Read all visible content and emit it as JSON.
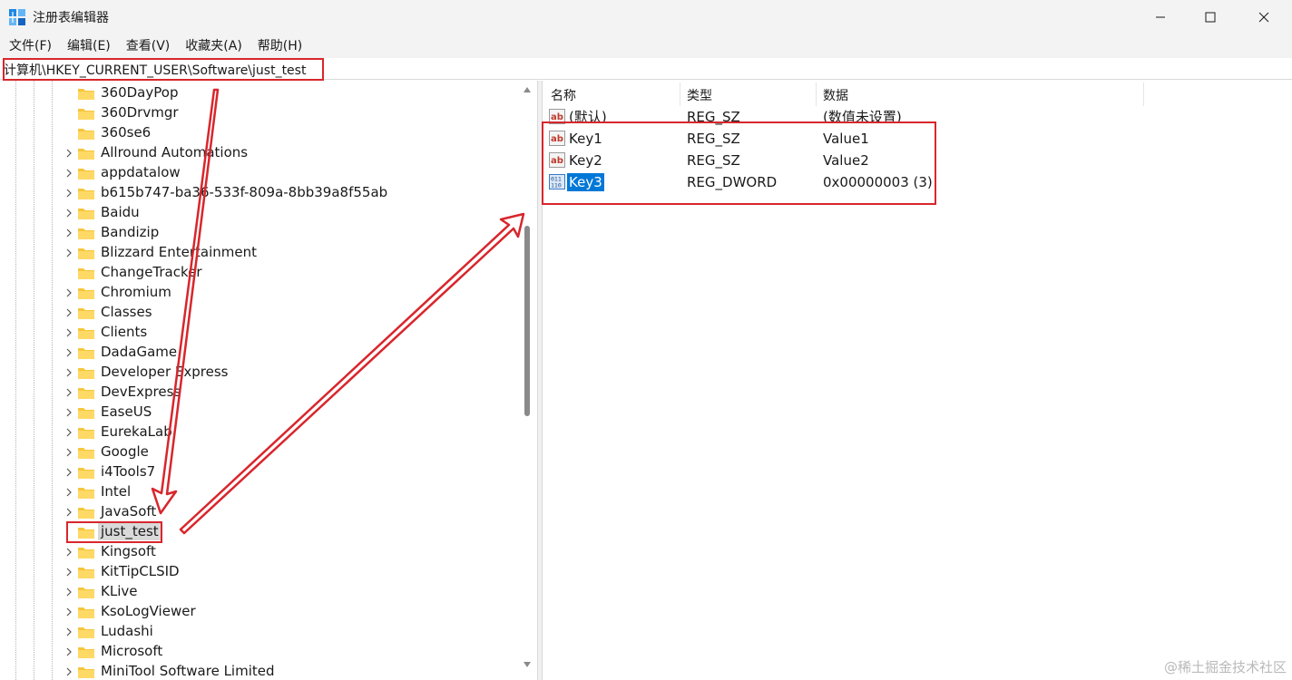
{
  "window": {
    "title": "注册表编辑器",
    "minimize_icon": "minimize-icon",
    "maximize_icon": "maximize-icon",
    "close_icon": "close-icon"
  },
  "menu": [
    "文件(F)",
    "编辑(E)",
    "查看(V)",
    "收藏夹(A)",
    "帮助(H)"
  ],
  "address": "计算机\\HKEY_CURRENT_USER\\Software\\just_test",
  "tree": {
    "items": [
      {
        "label": "360DayPop",
        "expandable": false
      },
      {
        "label": "360Drvmgr",
        "expandable": false
      },
      {
        "label": "360se6",
        "expandable": false
      },
      {
        "label": "Allround Automations",
        "expandable": true
      },
      {
        "label": "appdatalow",
        "expandable": true
      },
      {
        "label": "b615b747-ba36-533f-809a-8bb39a8f55ab",
        "expandable": true
      },
      {
        "label": "Baidu",
        "expandable": true
      },
      {
        "label": "Bandizip",
        "expandable": true
      },
      {
        "label": "Blizzard Entertainment",
        "expandable": true
      },
      {
        "label": "ChangeTracker",
        "expandable": false
      },
      {
        "label": "Chromium",
        "expandable": true
      },
      {
        "label": "Classes",
        "expandable": true
      },
      {
        "label": "Clients",
        "expandable": true
      },
      {
        "label": "DadaGame",
        "expandable": true
      },
      {
        "label": "Developer Express",
        "expandable": true
      },
      {
        "label": "DevExpress",
        "expandable": true
      },
      {
        "label": "EaseUS",
        "expandable": true
      },
      {
        "label": "EurekaLab",
        "expandable": true
      },
      {
        "label": "Google",
        "expandable": true
      },
      {
        "label": "i4Tools7",
        "expandable": true
      },
      {
        "label": "Intel",
        "expandable": true
      },
      {
        "label": "JavaSoft",
        "expandable": true
      },
      {
        "label": "just_test",
        "expandable": false,
        "selected": true
      },
      {
        "label": "Kingsoft",
        "expandable": true
      },
      {
        "label": "KitTipCLSID",
        "expandable": true
      },
      {
        "label": "KLive",
        "expandable": true
      },
      {
        "label": "KsoLogViewer",
        "expandable": true
      },
      {
        "label": "Ludashi",
        "expandable": true
      },
      {
        "label": "Microsoft",
        "expandable": true
      },
      {
        "label": "MiniTool Software Limited",
        "expandable": true
      }
    ]
  },
  "values": {
    "columns": {
      "name": "名称",
      "type": "类型",
      "data": "数据"
    },
    "rows": [
      {
        "name": "(默认)",
        "type": "REG_SZ",
        "data": "(数值未设置)",
        "icon": "string-value-icon"
      },
      {
        "name": "Key1",
        "type": "REG_SZ",
        "data": "Value1",
        "icon": "string-value-icon"
      },
      {
        "name": "Key2",
        "type": "REG_SZ",
        "data": "Value2",
        "icon": "string-value-icon"
      },
      {
        "name": "Key3",
        "type": "REG_DWORD",
        "data": "0x00000003 (3)",
        "icon": "binary-value-icon",
        "selected": true
      }
    ]
  },
  "annotation_color": "#d8262c",
  "selection_color": "#0078d7",
  "watermark": "@稀土掘金技术社区"
}
